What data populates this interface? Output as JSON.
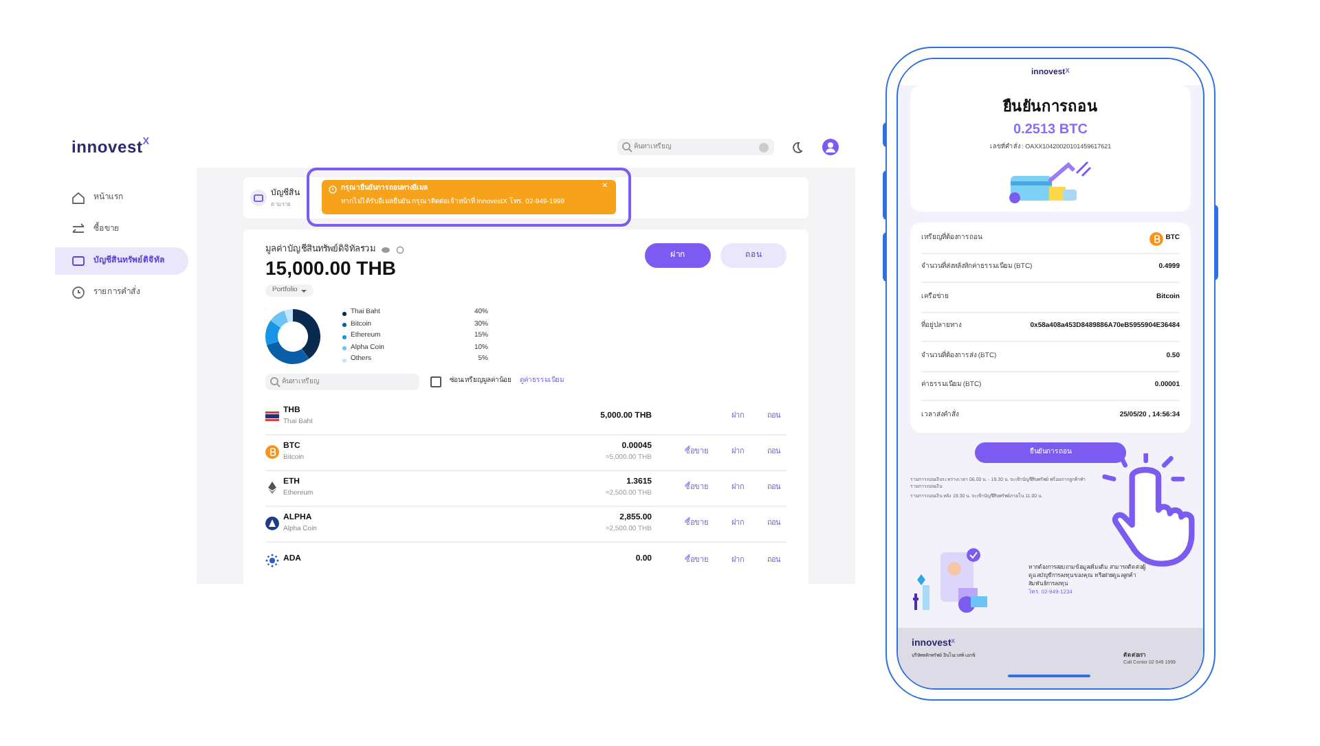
{
  "app": {
    "logo": "innovest",
    "logo_mark": "X",
    "search": {
      "placeholder": "ค้นหาเหรียญ"
    }
  },
  "sidebar": {
    "items": [
      {
        "label": "หน้าแรก",
        "selected": false
      },
      {
        "label": "ซื้อขาย",
        "selected": false
      },
      {
        "label": "บัญชีสินทรัพย์ดิจิทัล",
        "selected": true
      },
      {
        "label": "รายการคำสั่ง",
        "selected": false
      }
    ]
  },
  "account_card": {
    "title": "บัญชีสิน",
    "subtitle": "ตามราย"
  },
  "toast": {
    "title": "กรุณายืนยันการถอนทางอีเมล",
    "message": "หากไม่ได้รับอีเมลยืนยัน กรุณาติดต่อเจ้าหน้าที่ InnovestX โทร. 02-949-1999",
    "close": "×"
  },
  "portfolio": {
    "label": "มูลค่าบัญชีสินทรัพย์ดิจิทัลรวม",
    "total": "15,000.00 THB",
    "dropdown": "Portfolio",
    "buttons": [
      "ฝาก",
      "ถอน"
    ],
    "chart_data": {
      "type": "donut",
      "categories": [
        "Thai Baht",
        "Bitcoin",
        "Ethereum",
        "Alpha Coin",
        "Others"
      ],
      "values": [
        40,
        30,
        15,
        10,
        5
      ]
    },
    "legend": [
      {
        "pct": "40%",
        "color": "#0b2a4f"
      },
      {
        "pct": "30%",
        "color": "#0b5fa8"
      },
      {
        "pct": "15%",
        "color": "#1796e8"
      },
      {
        "pct": "10%",
        "color": "#6cc3f5"
      },
      {
        "pct": "5%",
        "color": "#c6e7fb"
      }
    ],
    "search": {
      "placeholder": "ค้นหาเหรียญ"
    },
    "hide_small": {
      "label": "ซ่อนเหรียญมูลค่าน้อย",
      "checked": false
    },
    "fee_link": "ดูค่าธรรมเนียม"
  },
  "assets": [
    {
      "kind": "thb",
      "symbol": "THB",
      "name": "Thai Baht",
      "amount": "5,000.00 THB",
      "actions": [
        "ฝาก",
        "ถอน"
      ]
    },
    {
      "kind": "btc",
      "symbol": "BTC",
      "name": "Bitcoin",
      "amount": "0.00045",
      "value": "≈5,000.00 THB",
      "actions": [
        "ซื้อขาย",
        "ฝาก",
        "ถอน"
      ]
    },
    {
      "kind": "eth",
      "symbol": "ETH",
      "name": "Ethereum",
      "amount": "1.3615",
      "value": "≈2,500.00 THB",
      "actions": [
        "ซื้อขาย",
        "ฝาก",
        "ถอน"
      ]
    },
    {
      "kind": "alpha",
      "symbol": "ALPHA",
      "name": "Alpha Coin",
      "amount": "2,855.00",
      "value": "≈2,500.00 THB",
      "actions": [
        "ซื้อขาย",
        "ฝาก",
        "ถอน"
      ]
    },
    {
      "kind": "ada",
      "symbol": "ADA",
      "amount": "0.00",
      "actions": [
        "ซื้อขาย",
        "ฝาก",
        "ถอน"
      ]
    }
  ],
  "phone": {
    "logo": "innovest",
    "logo_mark": "X",
    "title": "ยืนยันการถอน",
    "amount": "0.2513 BTC",
    "order_no": "เลขที่คำสั่ง : OAXX10420020101459617621",
    "details": [
      {
        "label": "เหรียญที่ต้องการถอน",
        "value": "BTC",
        "coin": true
      },
      {
        "label": "จำนวนที่ส่งหลังหักค่าธรรมเนียม (BTC)",
        "value": "0.4999"
      },
      {
        "label": "เครือข่าย",
        "value": "Bitcoin"
      },
      {
        "label": "ที่อยู่ปลายทาง",
        "value": "0x58a408a453D8489886A70eB5955904E36484"
      },
      {
        "label": "จำนวนที่ต้องการส่ง (BTC)",
        "value": "0.50"
      },
      {
        "label": "ค่าธรรมเนียม (BTC)",
        "value": "0.00001"
      },
      {
        "label": "เวลาส่งคำสั่ง",
        "value": "25/05/20 , 14:56:34"
      }
    ],
    "confirm": "ยืนยันการถอน",
    "notes": [
      "รายการถอนเงินระหว่างเวลา 06.00 น. - 19.30 น. จะเข้าบัญชีสินทรัพย์ พร้อมจากลูกค้าทำรายการถอนเงิน",
      "รายการถอนเงิน หลัง 19.30 น. จะเข้าบัญชีสินทรัพย์ภายใน 11.00 น."
    ],
    "help": "หากต้องการสอบถามข้อมูลเพิ่มเติม สามารถติดต่อผู้ดูแลบัญชีการลงทุนของคุณ หรือฝ่ายดูแลลูกค้าสัมพันธ์การลงทุน",
    "help_phone": "โทร. 02-949-1234",
    "footer": {
      "logo": "innovest",
      "logo_mark": "X",
      "company": "บริษัทหลักทรัพย์ อินโนเวสท์ เอกซ์",
      "contact_title": "ติดต่อเรา",
      "contact": "Call Center 02 949 1999"
    }
  }
}
